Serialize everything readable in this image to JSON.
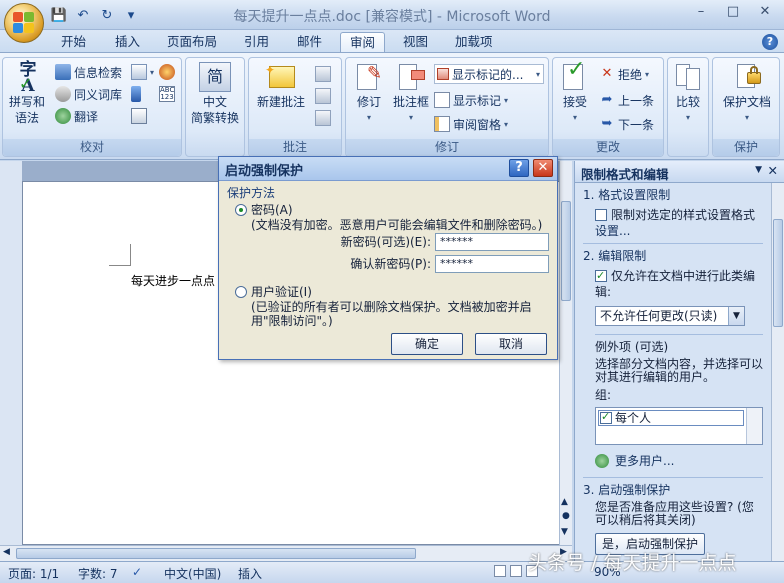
{
  "window": {
    "title": "每天提升一点点.doc [兼容模式] - Microsoft Word",
    "min": "–",
    "max": "□",
    "close": "✕"
  },
  "qat": {
    "save": "💾",
    "undo": "↶",
    "redo": "↻",
    "more": "▾"
  },
  "tabs": [
    "开始",
    "插入",
    "页面布局",
    "引用",
    "邮件",
    "审阅",
    "视图",
    "加载项"
  ],
  "active_tab": "审阅",
  "help_icon": "?",
  "ribbon": {
    "proofing": {
      "label": "校对",
      "spell": "拼写和\n语法",
      "research": "信息检索",
      "thesaurus": "同义词库",
      "translate": "翻译"
    },
    "chinese": {
      "label": "中文简繁转换",
      "icon_char": "简",
      "label1": "中文",
      "label2": "简繁转换"
    },
    "comments": {
      "label": "批注",
      "new": "新建批注"
    },
    "tracking": {
      "label": "修订",
      "track": "修订",
      "balloons": "批注框",
      "show_markup": "显示标记的...",
      "show_markup2": "显示标记",
      "review_pane": "审阅窗格"
    },
    "changes": {
      "label": "更改",
      "accept": "接受",
      "reject": "拒绝",
      "prev": "上一条",
      "next": "下一条"
    },
    "compare": {
      "label": "比较"
    },
    "protect": {
      "label": "保护",
      "protect_doc": "保护文档"
    }
  },
  "document": {
    "text": "每天进步一点点"
  },
  "pane": {
    "title": "限制格式和编辑",
    "dropdown": "▼",
    "close": "✕",
    "sec1": "1.  格式设置限制",
    "sec1_check": "限制对选定的样式设置格式",
    "sec1_link": "设置...",
    "sec2": "2.  编辑限制",
    "sec2_check": "仅允许在文档中进行此类编辑:",
    "sec2_select": "不允许任何更改(只读)",
    "exceptions_title": "例外项 (可选)",
    "exceptions_desc": "选择部分文档内容，并选择可以对其进行编辑的用户。",
    "group_label": "组:",
    "group_item": "每个人",
    "more_users": "更多用户...",
    "sec3": "3.  启动强制保护",
    "sec3_desc": "您是否准备应用这些设置? (您可以稍后将其关闭)",
    "start_btn": "是，启动强制保护"
  },
  "dialog": {
    "title": "启动强制保护",
    "help": "?",
    "close": "✕",
    "group": "保护方法",
    "pw_option": "密码(A)",
    "pw_desc": "(文档没有加密。恶意用户可能会编辑文件和删除密码。)",
    "new_pw_label": "新密码(可选)(E):",
    "new_pw_value": "******",
    "confirm_pw_label": "确认新密码(P):",
    "confirm_pw_value": "******",
    "user_option": "用户验证(I)",
    "user_desc": "(已验证的所有者可以删除文档保护。文档被加密并启用\"限制访问\"。)",
    "ok": "确定",
    "cancel": "取消"
  },
  "status": {
    "page": "页面: 1/1",
    "words": "字数: 7",
    "lang": "中文(中国)",
    "mode": "插入",
    "zoom": "90%"
  },
  "watermark": "头条号 / 每天提升一点点"
}
